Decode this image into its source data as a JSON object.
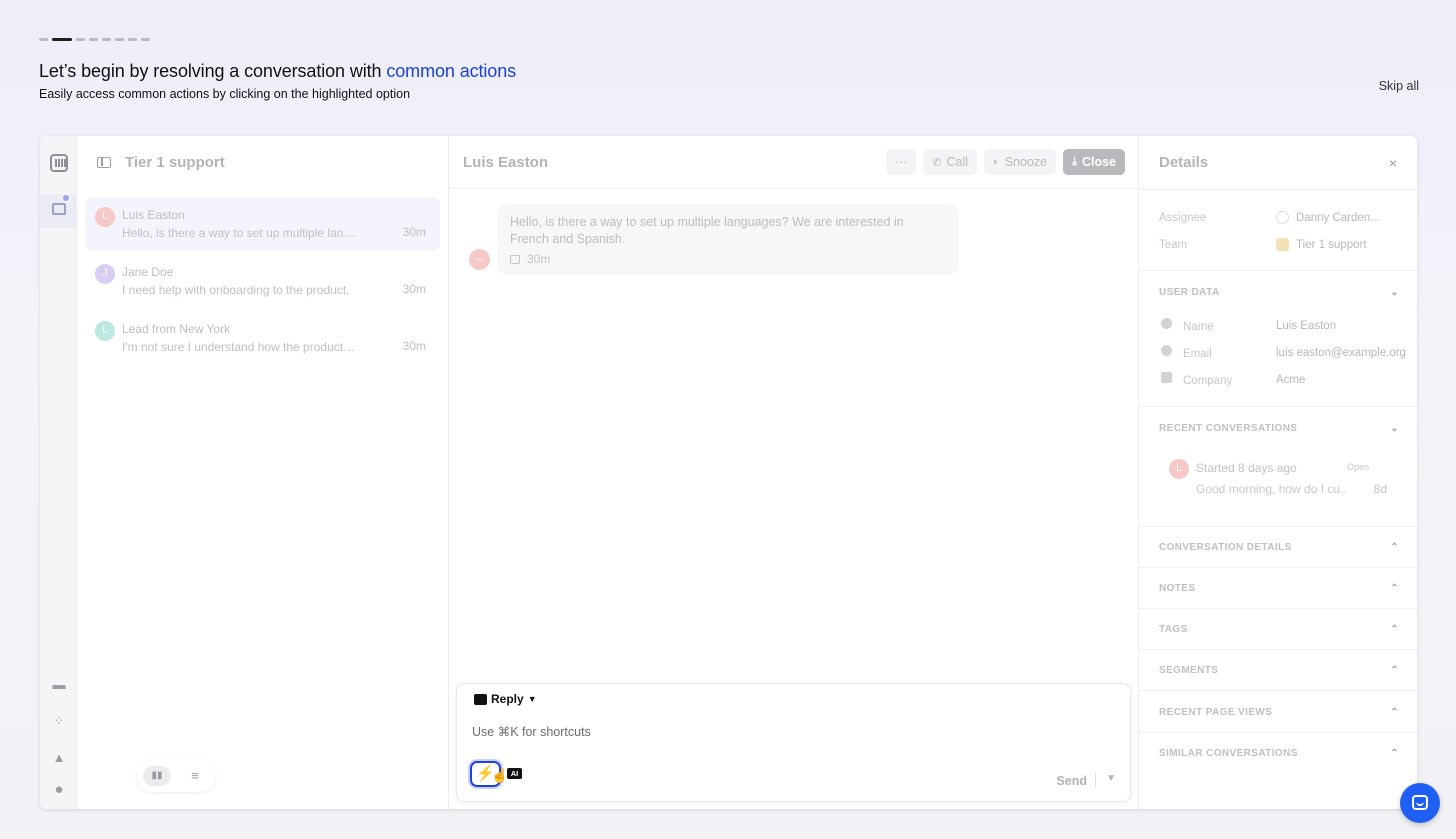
{
  "tour": {
    "title_prefix": "Let’s begin by resolving a conversation with ",
    "title_highlight": "common actions",
    "subtitle": "Easily access common actions by clicking on the highlighted option",
    "skip": "Skip all",
    "steps_total": 8,
    "step_current": 2
  },
  "list": {
    "title": "Tier 1 support",
    "conversations": [
      {
        "initial": "L",
        "name": "Luis Easton",
        "preview": "Hello, is there a way to set up multiple langu...",
        "time": "30m",
        "color": "#f6c8c8"
      },
      {
        "initial": "J",
        "name": "Jane Doe",
        "preview": "I need help with onboarding to the product.",
        "time": "30m",
        "color": "#d8cdf3"
      },
      {
        "initial": "L",
        "name": "Lead from New York",
        "preview": "I'm not sure I understand how the product w...",
        "time": "30m",
        "color": "#bde8df"
      }
    ]
  },
  "main": {
    "title": "Luis Easton",
    "more": "···",
    "call": "Call",
    "snooze": "Snooze",
    "close": "Close",
    "message": {
      "text": "Hello, is there a way to set up multiple languages? We are interested in French and Spanish.",
      "time": "30m",
      "avatar": "–"
    },
    "composer": {
      "mode": "Reply",
      "placeholder": "Use ⌘K for shortcuts",
      "ai_badge": "AI",
      "send": "Send"
    }
  },
  "details": {
    "title": "Details",
    "close": "×",
    "assignee_label": "Assignee",
    "assignee_value": "Danny Carden...",
    "team_label": "Team",
    "team_value": "Tier 1 support",
    "user_data": {
      "heading": "USER DATA",
      "name_label": "Name",
      "name_value": "Luis Easton",
      "email_label": "Email",
      "email_value": "luis easton@example.org",
      "company_label": "Company",
      "company_value": "Acme"
    },
    "recent": {
      "heading": "RECENT CONVERSATIONS",
      "title": "Started 8 days ago",
      "preview": "Good morning, how do I cu..",
      "status": "Open",
      "time": "8d",
      "initial": "L"
    },
    "sections": [
      "CONVERSATION DETAILS",
      "NOTES",
      "TAGS",
      "SEGMENTS",
      "RECENT PAGE VIEWS",
      "SIMILAR CONVERSATIONS"
    ]
  },
  "colors": {
    "accent": "#1b3fd8",
    "messenger": "#1f5ff3"
  }
}
